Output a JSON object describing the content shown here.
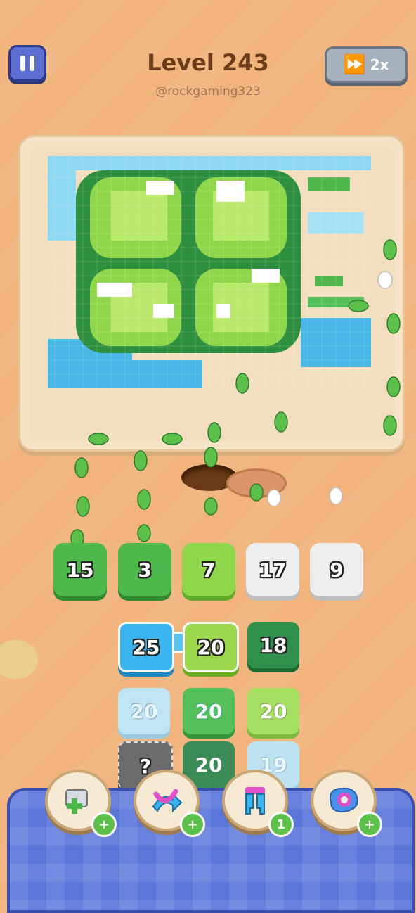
{
  "header": {
    "level_title": "Level 243",
    "username": "@rockgaming323",
    "speed_label": "2x"
  },
  "slots": [
    {
      "value": "15",
      "color": "#4fb84d"
    },
    {
      "value": "3",
      "color": "#4fb84d"
    },
    {
      "value": "7",
      "color": "#8fd64b"
    },
    {
      "value": "17",
      "color": "#eeeeee"
    },
    {
      "value": "9",
      "color": "#eeeeee"
    }
  ],
  "grid": {
    "row1": [
      "25",
      "20",
      "18"
    ],
    "row2": [
      "20",
      "20",
      "20"
    ],
    "row3": [
      "?",
      "20",
      "19"
    ]
  },
  "tools": [
    {
      "icon": "add-slot-icon",
      "badge": "+"
    },
    {
      "icon": "shuffle-icon",
      "badge": "+"
    },
    {
      "icon": "magnet-icon",
      "badge": "1"
    },
    {
      "icon": "paint-icon",
      "badge": "+"
    }
  ],
  "colors": {
    "background": "#f0b47c",
    "panel": "#5b76d9",
    "pause_button": "#5d6fd0",
    "green": "#4fb84d",
    "lime": "#8fd64b",
    "sky": "#39b4ef"
  }
}
